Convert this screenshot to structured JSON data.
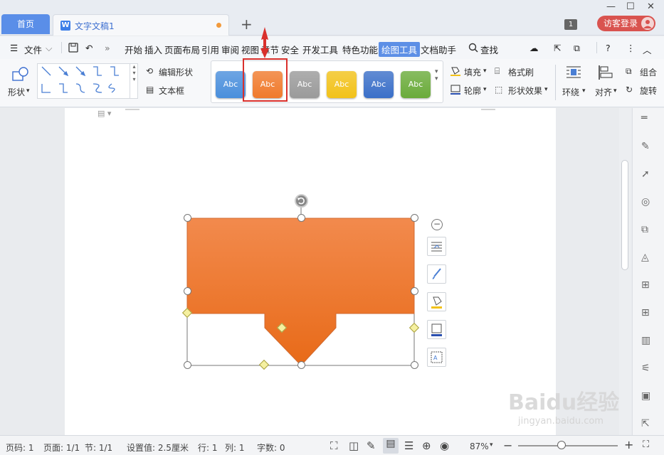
{
  "tabs": {
    "home": "首页",
    "doc_title": "文字文稿1",
    "doc_icon": "W",
    "add": "+"
  },
  "titlebar": {
    "badge": "1",
    "login": "访客登录"
  },
  "menu": {
    "file": "文件",
    "items": [
      "开始",
      "插入",
      "页面布局",
      "引用",
      "审阅",
      "视图",
      "章节",
      "安全",
      "开发工具",
      "特色功能"
    ],
    "active": "绘图工具",
    "doc_helper": "文档助手",
    "search": "查找"
  },
  "ribbon": {
    "shape": "形状",
    "edit_shape": "编辑形状",
    "text_box": "文本框",
    "style_labels": [
      "Abc",
      "Abc",
      "Abc",
      "Abc",
      "Abc",
      "Abc"
    ],
    "style_colors": [
      "#4a8fdc",
      "#f07a2c",
      "#9a9a9a",
      "#f2c21a",
      "#3a6fc8",
      "#6aab3a"
    ],
    "fill": "填充",
    "outline": "轮廓",
    "format_brush": "格式刷",
    "shape_effect": "形状效果",
    "wrap": "环绕",
    "align": "对齐",
    "group": "组合",
    "rotate": "旋转"
  },
  "statusbar": {
    "page_no": "页码: 1",
    "pages": "页面: 1/1",
    "section": "节: 1/1",
    "setting": "设置值: 2.5厘米",
    "row": "行: 1",
    "col": "列: 1",
    "words": "字数: 0",
    "zoom": "87%"
  },
  "watermark": {
    "line1": "Baidu经验",
    "line2": "jingyan.baidu.com"
  },
  "colors": {
    "accent": "#5d8fe6",
    "shape_orange": "#f07a2c",
    "highlight_red": "#d9302c"
  }
}
